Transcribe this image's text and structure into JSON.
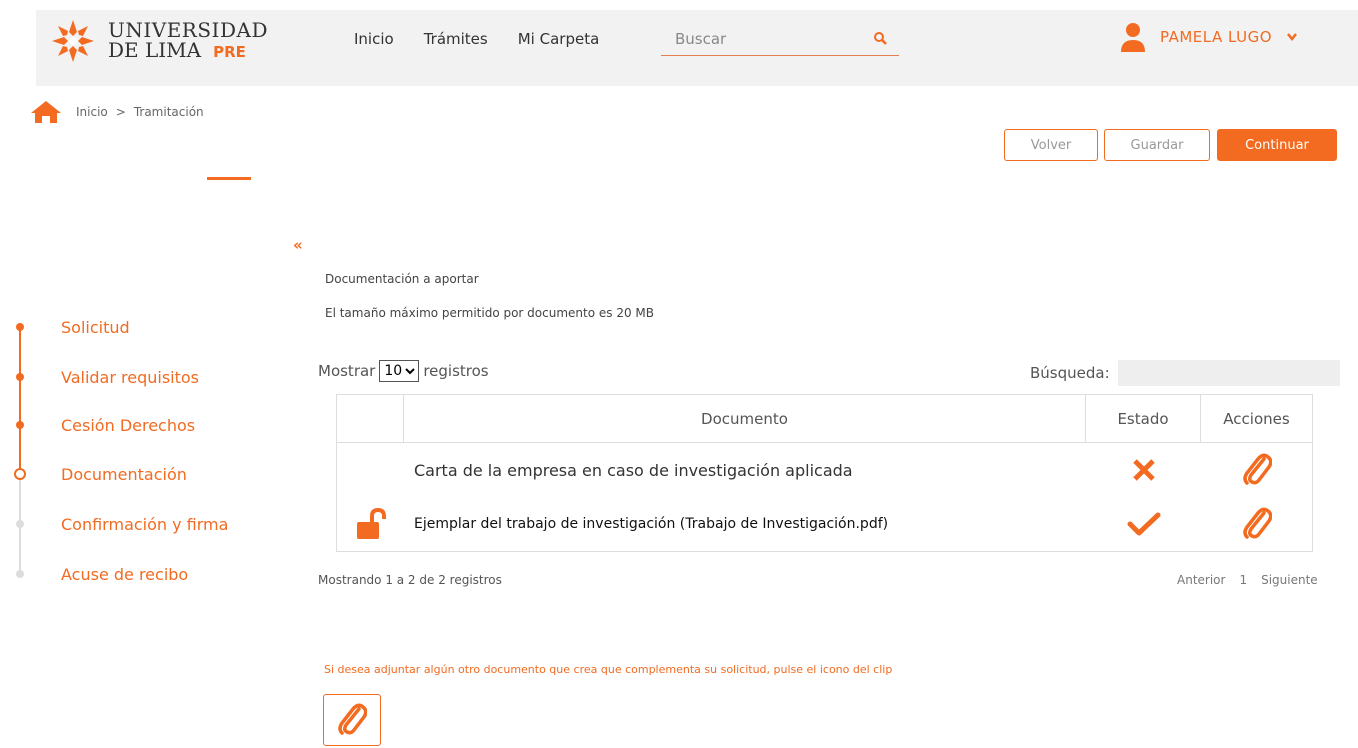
{
  "header": {
    "logo_line1": "UNIVERSIDAD",
    "logo_line2": "DE LIMA",
    "logo_pre": "PRE",
    "nav": [
      "Inicio",
      "Trámites",
      "Mi Carpeta"
    ],
    "search_placeholder": "Buscar",
    "user_name": "PAMELA LUGO"
  },
  "breadcrumb": {
    "home": "Inicio",
    "separator": ">",
    "current": "Tramitación"
  },
  "actions": {
    "volver": "Volver",
    "guardar": "Guardar",
    "continuar": "Continuar"
  },
  "sidebar_collapse": "«",
  "steps": [
    {
      "label": "Solicitud",
      "state": "done"
    },
    {
      "label": "Validar requisitos",
      "state": "done"
    },
    {
      "label": "Cesión Derechos",
      "state": "done"
    },
    {
      "label": "Documentación",
      "state": "current"
    },
    {
      "label": "Confirmación y firma",
      "state": "pending"
    },
    {
      "label": "Acuse de recibo",
      "state": "pending"
    }
  ],
  "content": {
    "title": "Documentación a aportar",
    "subtitle": "El tamaño máximo permitido por documento es 20 MB"
  },
  "table_controls": {
    "show_prefix": "Mostrar",
    "page_size": "10",
    "show_suffix": "registros",
    "search_label": "Búsqueda:"
  },
  "table": {
    "headers": [
      "",
      "Documento",
      "Estado",
      "Acciones"
    ],
    "rows": [
      {
        "icon": "none",
        "document": "Carta de la empresa en caso de investigación aplicada",
        "status": "x-icon",
        "action": "paperclip-icon"
      },
      {
        "icon": "unlock-icon",
        "document": "Ejemplar del trabajo de investigación (Trabajo de Investigación.pdf)",
        "status": "check-icon",
        "action": "paperclip-icon"
      }
    ]
  },
  "footer": {
    "info": "Mostrando 1 a 2 de 2 registros",
    "prev": "Anterior",
    "page": "1",
    "next": "Siguiente"
  },
  "attach_note": "Si desea adjuntar algún otro documento que crea que complementa su solicitud, pulse el icono del clip",
  "colors": {
    "accent": "#f26b21",
    "header_bg": "#f2f2f2"
  }
}
